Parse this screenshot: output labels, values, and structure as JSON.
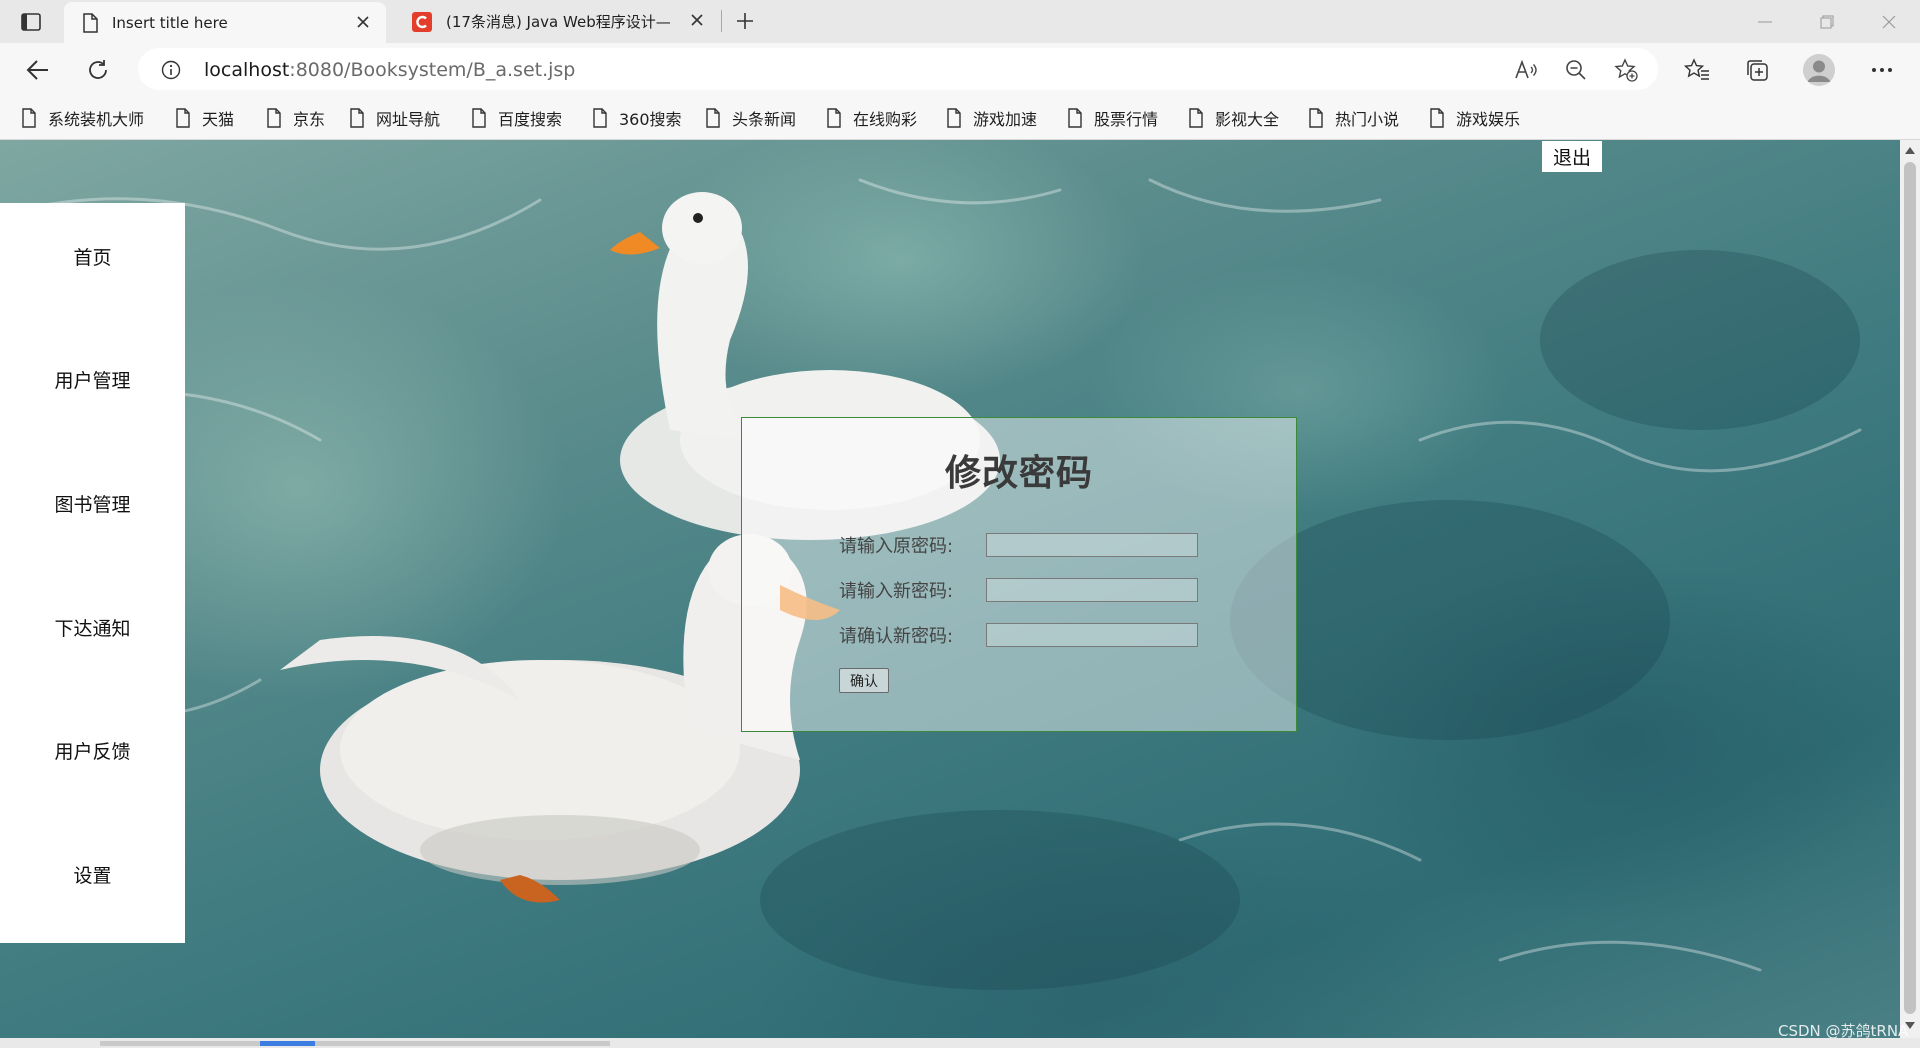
{
  "tabs": [
    {
      "title": "Insert title here",
      "active": true
    },
    {
      "title": "(17条消息) Java Web程序设计—",
      "active": false
    }
  ],
  "toolbar": {
    "url_host": "localhost",
    "url_rest": ":8080/Booksystem/B_a.set.jsp"
  },
  "bookmarks": [
    "系统装机大师",
    "天猫",
    "京东",
    "网址导航",
    "百度搜索",
    "360搜索",
    "头条新闻",
    "在线购彩",
    "游戏加速",
    "股票行情",
    "影视大全",
    "热门小说",
    "游戏娱乐"
  ],
  "sidebar": {
    "items": [
      {
        "label": "首页"
      },
      {
        "label": "用户管理"
      },
      {
        "label": "图书管理"
      },
      {
        "label": "下达通知"
      },
      {
        "label": "用户反馈"
      },
      {
        "label": "设置"
      }
    ]
  },
  "header": {
    "logout_label": "退出"
  },
  "form": {
    "title": "修改密码",
    "old_password_label": "请输入原密码:",
    "new_password_label": "请输入新密码:",
    "confirm_password_label": "请确认新密码:",
    "old_password_value": "",
    "new_password_value": "",
    "confirm_password_value": "",
    "submit_label": "确认"
  },
  "watermark": "CSDN @苏鸽tRNA",
  "colors": {
    "accent_border": "#3a8a3a",
    "water": "#3f7b80"
  },
  "icons": {
    "close": "close-icon",
    "new_tab": "plus-icon",
    "back": "back-arrow-icon",
    "refresh": "refresh-icon",
    "info": "info-icon",
    "read_aloud": "read-aloud-icon",
    "zoom": "zoom-out-icon",
    "favorite": "add-favorite-icon",
    "favorites": "favorites-icon",
    "collections": "collections-icon",
    "more": "more-icon",
    "page": "page-icon"
  }
}
